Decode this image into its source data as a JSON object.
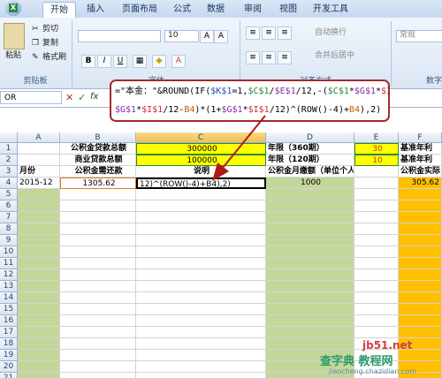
{
  "tabs": [
    "开始",
    "插入",
    "页面布局",
    "公式",
    "数据",
    "审阅",
    "视图",
    "开发工具"
  ],
  "ribbon": {
    "paste_label": "粘贴",
    "cut_label": "剪切",
    "copy_label": "复制",
    "format_painter_label": "格式刷",
    "clipboard_group": "剪贴板",
    "font_size": "10",
    "font_group": "字体",
    "bold": "B",
    "italic": "I",
    "underline": "U",
    "wrap_text": "自动换行",
    "merge_center": "合并后居中",
    "align_group": "对齐方式",
    "number_format": "常规",
    "number_group": "数字"
  },
  "formula_bar": {
    "name_box": "OR",
    "fx": "fx",
    "line1": [
      {
        "t": "=\"本金：\"&ROUND(IF(",
        "c": "black"
      },
      {
        "t": "$K$1",
        "c": "blue"
      },
      {
        "t": "=1,",
        "c": "black"
      },
      {
        "t": "$C$1",
        "c": "green"
      },
      {
        "t": "/",
        "c": "black"
      },
      {
        "t": "$E$1",
        "c": "purple"
      },
      {
        "t": "/12,-(",
        "c": "black"
      },
      {
        "t": "$C$1",
        "c": "green"
      },
      {
        "t": "*",
        "c": "black"
      },
      {
        "t": "$G$1",
        "c": "purple"
      },
      {
        "t": "*",
        "c": "black"
      },
      {
        "t": "$I$1",
        "c": "red"
      },
      {
        "t": "/12-",
        "c": "black"
      },
      {
        "t": "B4",
        "c": "orange"
      }
    ],
    "line2": [
      {
        "t": "$G$1",
        "c": "purple"
      },
      {
        "t": "*",
        "c": "black"
      },
      {
        "t": "$I$1",
        "c": "red"
      },
      {
        "t": "/12-",
        "c": "black"
      },
      {
        "t": "B4",
        "c": "orange"
      },
      {
        "t": ")*(1+",
        "c": "black"
      },
      {
        "t": "$G$1",
        "c": "purple"
      },
      {
        "t": "*",
        "c": "black"
      },
      {
        "t": "$I$1",
        "c": "red"
      },
      {
        "t": "/12)^(ROW()-4)+",
        "c": "black"
      },
      {
        "t": "B4",
        "c": "orange"
      },
      {
        "t": "),2)",
        "c": "black"
      }
    ]
  },
  "sheet": {
    "columns": [
      "A",
      "B",
      "C",
      "D",
      "E",
      "F"
    ],
    "rows": [
      "1",
      "2",
      "3",
      "4",
      "5",
      "6",
      "7",
      "8",
      "9",
      "10",
      "11",
      "12",
      "13",
      "14",
      "15",
      "16",
      "17",
      "18",
      "19",
      "20",
      "21",
      "22"
    ],
    "B1": "公积金贷款总额",
    "C1": "300000",
    "D1": "年限（360期）",
    "E1": "30",
    "F1": "基准年利",
    "B2": "商业贷款总额",
    "C2": "100000",
    "D2": "年限（120期）",
    "E2": "10",
    "F2": "基准年利",
    "A3": "月份",
    "B3": "公积金需还款",
    "C3": "说明",
    "D3": "公积金月缴额（单位个人）",
    "F3": "公积金实际",
    "A4": "2015-12",
    "B4": "1305.62",
    "C4": "12)^(ROW()-4)+B4),2)",
    "D4": "1000",
    "F4": "305.62"
  },
  "watermark": {
    "line1": "jb51.net",
    "line2": "查字典 教程网",
    "line3": "jiaocheng.chazidian.com"
  }
}
